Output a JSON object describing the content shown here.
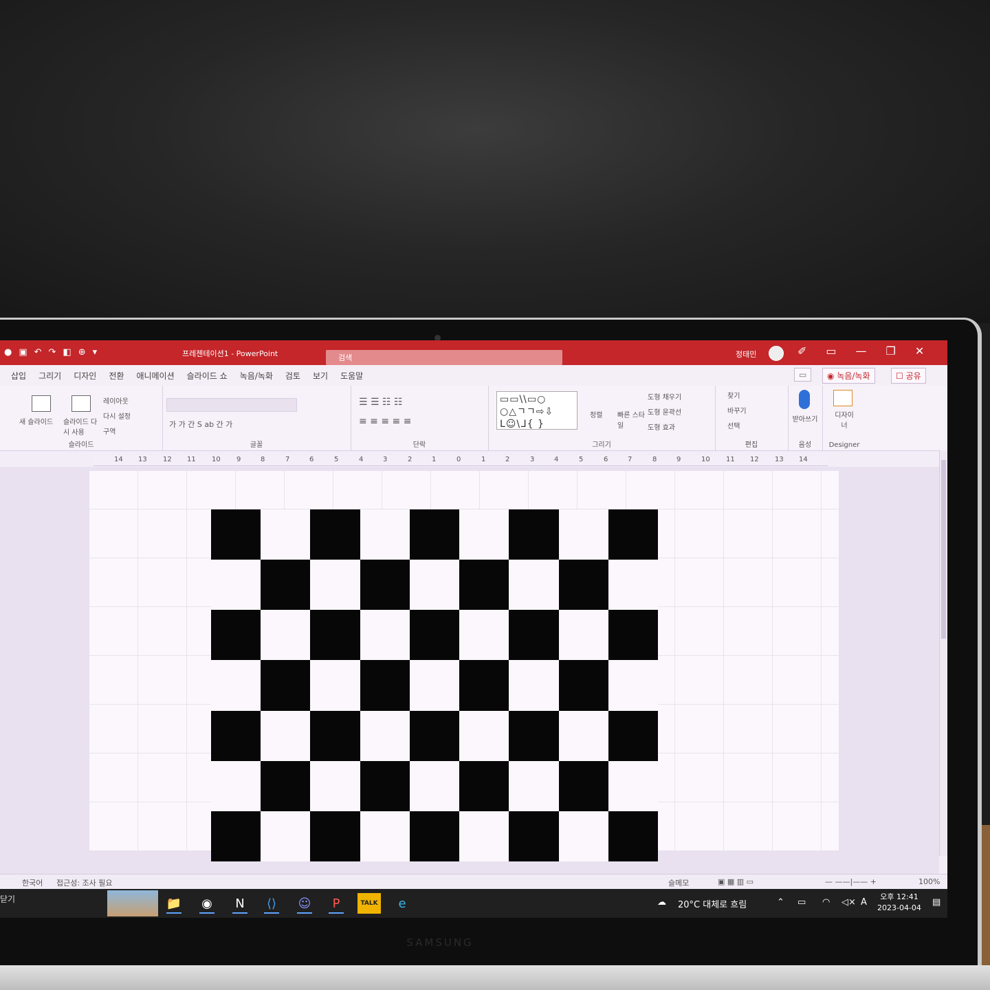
{
  "title_bar": {
    "qat_icons": [
      "record-icon",
      "save-icon",
      "undo-icon",
      "redo-icon",
      "presentation-icon",
      "format-icon",
      "customize-icon"
    ],
    "qat_glyphs": [
      "●",
      "▣",
      "↶",
      "↷",
      "◧",
      "⊕",
      "▾"
    ],
    "document_title": "프레젠테이션1 - PowerPoint",
    "search_placeholder": "검색",
    "user_name": "정태민",
    "window_buttons": [
      "✐",
      "▭",
      "—",
      "❐",
      "✕"
    ]
  },
  "ribbon_tabs": [
    "삽입",
    "그리기",
    "디자인",
    "전환",
    "애니메이션",
    "슬라이드 쇼",
    "녹음/녹화",
    "검토",
    "보기",
    "도움말"
  ],
  "ribbon_actions": {
    "comment": "▭",
    "record": "◉ 녹음/녹화",
    "share": "☐ 공유"
  },
  "ribbon_groups": {
    "slides": {
      "label": "슬라이드",
      "new_slide": "새 슬라이드",
      "reuse_slide": "슬라이드 다시 사용",
      "layout": "레이아웃",
      "reset": "다시 설정",
      "section": "구역"
    },
    "font": {
      "label": "글꼴",
      "format_row": "가  가  간  S  ab  간  가"
    },
    "paragraph": {
      "label": "단락"
    },
    "drawing": {
      "label": "그리기",
      "shapes_row1": "▭▭\\\\▭○",
      "shapes_row2": "○△ㄱㄱ⇨⇩",
      "shapes_row3": "ᒪ☺\\ᒧ{ }",
      "arrange": "정렬",
      "quick_styles": "빠른 스타일",
      "fill": "도형 채우기",
      "outline": "도형 윤곽선",
      "effects": "도형 효과"
    },
    "editing": {
      "label": "편집",
      "find": "찾기",
      "replace": "바꾸기",
      "select": "선택"
    },
    "voice": {
      "label": "음성",
      "dictate": "받아쓰기"
    },
    "designer": {
      "label": "Designer",
      "design_ideas": "디자이너"
    }
  },
  "ruler_ticks": [
    "14",
    "13",
    "12",
    "11",
    "10",
    "9",
    "8",
    "7",
    "6",
    "5",
    "4",
    "3",
    "2",
    "1",
    "0",
    "1",
    "2",
    "3",
    "4",
    "5",
    "6",
    "7",
    "8",
    "9",
    "10",
    "11",
    "12",
    "13",
    "14"
  ],
  "slide": {
    "checkerboard": {
      "columns": 9,
      "rows": 7,
      "dark_color": "#070707",
      "light_color": "#fbf7fc"
    }
  },
  "status_bar": {
    "language": "한국어",
    "accessibility": "접근성: 조사 필요",
    "notes": "슬메모",
    "zoom": "100%"
  },
  "taskbar": {
    "close_label": "닫기",
    "apps": [
      {
        "name": "file-explorer-icon",
        "glyph": "📁"
      },
      {
        "name": "chrome-icon",
        "glyph": "◉"
      },
      {
        "name": "notion-icon",
        "glyph": "N"
      },
      {
        "name": "vscode-icon",
        "glyph": "⟨⟩"
      },
      {
        "name": "discord-icon",
        "glyph": "☺"
      },
      {
        "name": "powerpoint-icon",
        "glyph": "P"
      },
      {
        "name": "kakaotalk-icon",
        "glyph": "TALK"
      },
      {
        "name": "edge-icon",
        "glyph": "e"
      }
    ],
    "weather": "20°C 대체로 흐림",
    "time": "오후 12:41",
    "date": "2023-04-04"
  },
  "laptop": {
    "brand": "SAMSUNG"
  }
}
